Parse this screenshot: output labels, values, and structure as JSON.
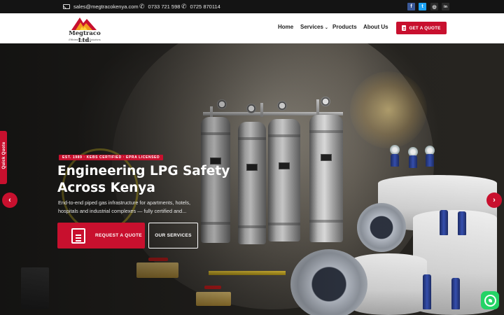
{
  "topbar": {
    "email": "sales@megtracokenya.com",
    "phone1": "0733 721 598",
    "phone2": "0725 870114",
    "social": [
      {
        "name": "facebook-icon",
        "glyph": "f",
        "color": "#3b5998"
      },
      {
        "name": "twitter-icon",
        "glyph": "t",
        "color": "#1da1f2"
      },
      {
        "name": "instagram-icon",
        "glyph": "◎",
        "color": "#2b2b2b"
      },
      {
        "name": "linkedin-icon",
        "glyph": "in",
        "color": "#2b2b2b"
      }
    ]
  },
  "header": {
    "logo_name": "Megtraco Ltd.",
    "logo_tagline": "Efficient Energy Solutions",
    "nav": [
      {
        "label": "Home"
      },
      {
        "label": "Services"
      },
      {
        "label": "Products"
      },
      {
        "label": "About Us"
      }
    ],
    "cta_label": "GET A QUOTE"
  },
  "hero": {
    "badge": "EST. 1989 · KEBS CERTIFIED · EPRA LICENSED",
    "title": "Engineering LPG Safety Across Kenya",
    "description": "End-to-end piped gas infrastructure for apartments, hotels, hospitals and industrial complexes — fully certified and...",
    "primary_button": "REQUEST A QUOTE",
    "secondary_button": "OUR SERVICES",
    "prev_arrow": "‹",
    "next_arrow": "›"
  },
  "side_tab": {
    "label": "Quick Quote"
  },
  "colors": {
    "accent": "#c8102e",
    "topbar": "#141414",
    "whatsapp": "#25d366"
  }
}
